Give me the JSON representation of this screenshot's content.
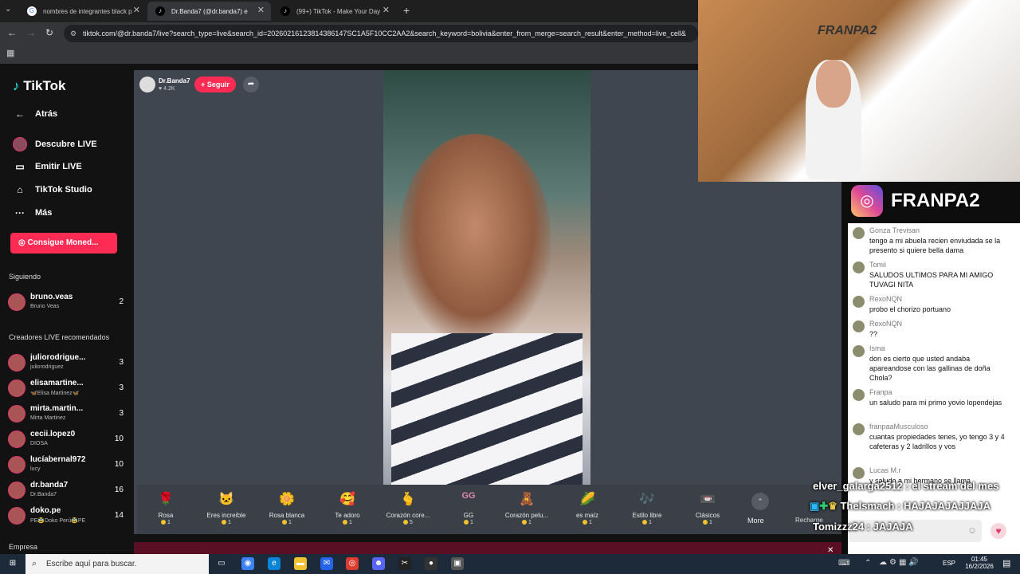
{
  "browser": {
    "tabs": [
      {
        "label": "nombres de integrantes black p"
      },
      {
        "label": "Dr.Banda7 (@dr.banda7) e"
      },
      {
        "label": "(99+) TikTok - Make Your Day"
      }
    ],
    "new_tab": "+",
    "url": "tiktok.com/@dr.banda7/live?search_type=live&search_id=20260216123814386147SC1A5F10CC2AA2&search_keyword=bolivia&enter_from_merge=search_result&enter_method=live_cell&"
  },
  "sidebar": {
    "logo": "TikTok",
    "back": "Atrás",
    "nav": [
      {
        "label": "Descubre LIVE",
        "icon": "live-avatar-icon"
      },
      {
        "label": "Emitir LIVE",
        "icon": "camera-icon"
      },
      {
        "label": "TikTok Studio",
        "icon": "home-icon"
      },
      {
        "label": "Más",
        "icon": "more-icon"
      }
    ],
    "coins_button": "Consigue Moned...",
    "following_title": "Siguiendo",
    "following": [
      {
        "name": "bruno.veas",
        "sub": "Bruno Veas",
        "count": "2"
      }
    ],
    "recommended_title": "Creadores LIVE recomendados",
    "recommended": [
      {
        "name": "juliorodrigue...",
        "sub": "juliorodriguez",
        "count": "3"
      },
      {
        "name": "elisamartine...",
        "sub": "🦋Elisa Martinez🦋",
        "count": "3"
      },
      {
        "name": "mirta.martin...",
        "sub": "Mirta Martinez",
        "count": "3"
      },
      {
        "name": "cecii.lopez0",
        "sub": "DIOSA",
        "count": "10"
      },
      {
        "name": "lucíabernal972",
        "sub": "lucy",
        "count": "10"
      },
      {
        "name": "dr.banda7",
        "sub": "Dr.Banda7",
        "count": "16"
      },
      {
        "name": "doko.pe",
        "sub": "PE🥸Doko Perú🥸PE",
        "count": "14"
      }
    ],
    "company": "Empresa"
  },
  "live": {
    "host_name": "Dr.Banda7",
    "likes": "4.2K",
    "follow": "+ Seguir",
    "gifts": [
      {
        "label": "Rosa",
        "price": "1",
        "icon": "🌹"
      },
      {
        "label": "Eres increíble",
        "price": "1",
        "icon": "🐱"
      },
      {
        "label": "Rosa blanca",
        "price": "1",
        "icon": "🌼"
      },
      {
        "label": "Te adoro",
        "price": "1",
        "icon": "🥰"
      },
      {
        "label": "Corazón core...",
        "price": "5",
        "icon": "🫰"
      },
      {
        "label": "GG",
        "price": "1",
        "icon": "GG"
      },
      {
        "label": "Corazón pelu...",
        "price": "1",
        "icon": "🧸"
      },
      {
        "label": "es maíz",
        "price": "1",
        "icon": "🌽"
      },
      {
        "label": "Estilo libre",
        "price": "1",
        "icon": "🎶"
      },
      {
        "label": "Clásicos",
        "price": "1",
        "icon": "📼"
      }
    ],
    "more": "More",
    "recharge": "Recharge"
  },
  "stream_overlay": {
    "brand": "FRANPA2",
    "chat": [
      {
        "user": "Gonza Trevisan",
        "text": "tengo a mi abuela recien enviudada se la presento si quiere bella dama"
      },
      {
        "user": "Tomii",
        "text": "SALUDOS ULTIMOS PARA MI AMIGO TUVAGI NITA"
      },
      {
        "user": "RexoNQN",
        "text": "probo el chorizo portuano"
      },
      {
        "user": "RexoNQN",
        "text": "??"
      },
      {
        "user": "Isma",
        "text": "don es cierto que usted andaba apareandose con las gallinas de doña Chola?"
      },
      {
        "user": "Franpa",
        "text": "un saludo para mi primo yovio lopendejas"
      },
      {
        "user": "franpaaMusculoso",
        "text": "cuantas propiedades tenes, yo tengo 3 y 4 cafeteras y 2 ladrillos y vos"
      },
      {
        "user": "Lucas M.r",
        "text": "y saludo a mi hermano se llama"
      }
    ],
    "overlay_lines": [
      "elver_galarga2512 : el stream del mes",
      "Thelsmach : HAJAJAJAJJAJA",
      "Tomizzz24 : JAJAJA"
    ]
  },
  "taskbar": {
    "search_placeholder": "Escribe aquí para buscar.",
    "lang": "ESP",
    "time": "01:45",
    "date": "16/2/2026"
  }
}
